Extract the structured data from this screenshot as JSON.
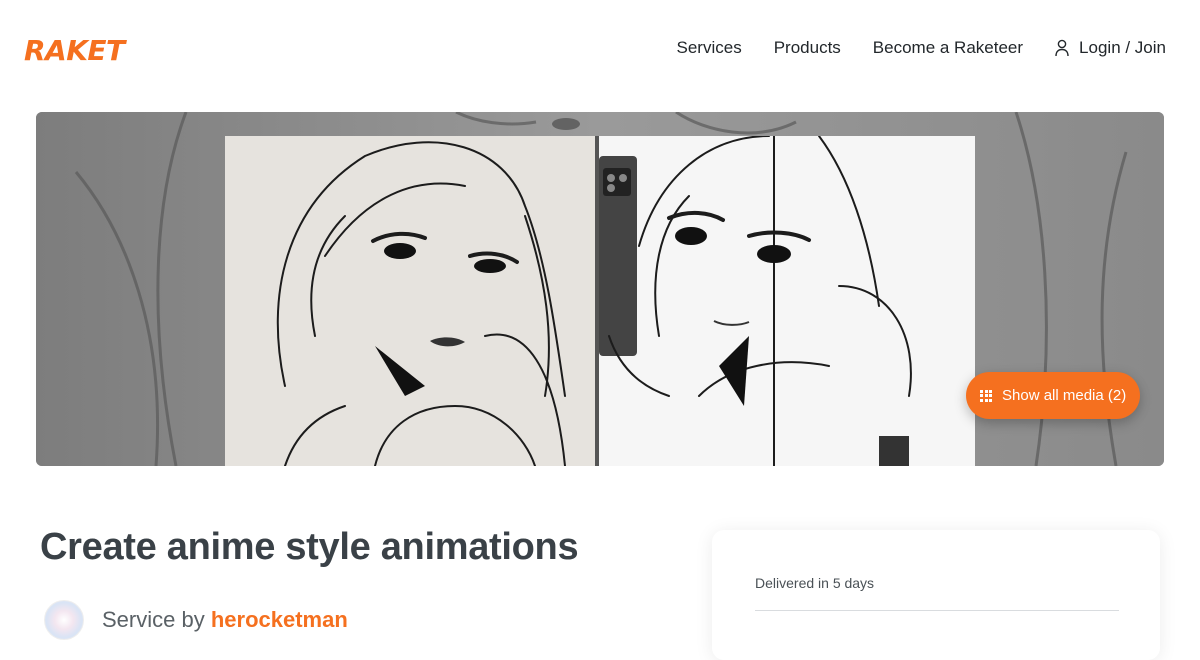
{
  "header": {
    "logo_text": "RAKET",
    "nav": {
      "services": "Services",
      "products": "Products",
      "become": "Become a Raketeer",
      "login": "Login / Join"
    }
  },
  "gallery": {
    "show_media_label": "Show all media (2)"
  },
  "listing": {
    "title": "Create anime style animations",
    "service_by_prefix": "Service by",
    "seller_name": "herocketman",
    "delivery_text": "Delivered in 5 days"
  },
  "colors": {
    "brand": "#f5701f",
    "title": "#3a4147"
  },
  "icons": {
    "user": "user-icon",
    "grid": "grid-icon"
  }
}
